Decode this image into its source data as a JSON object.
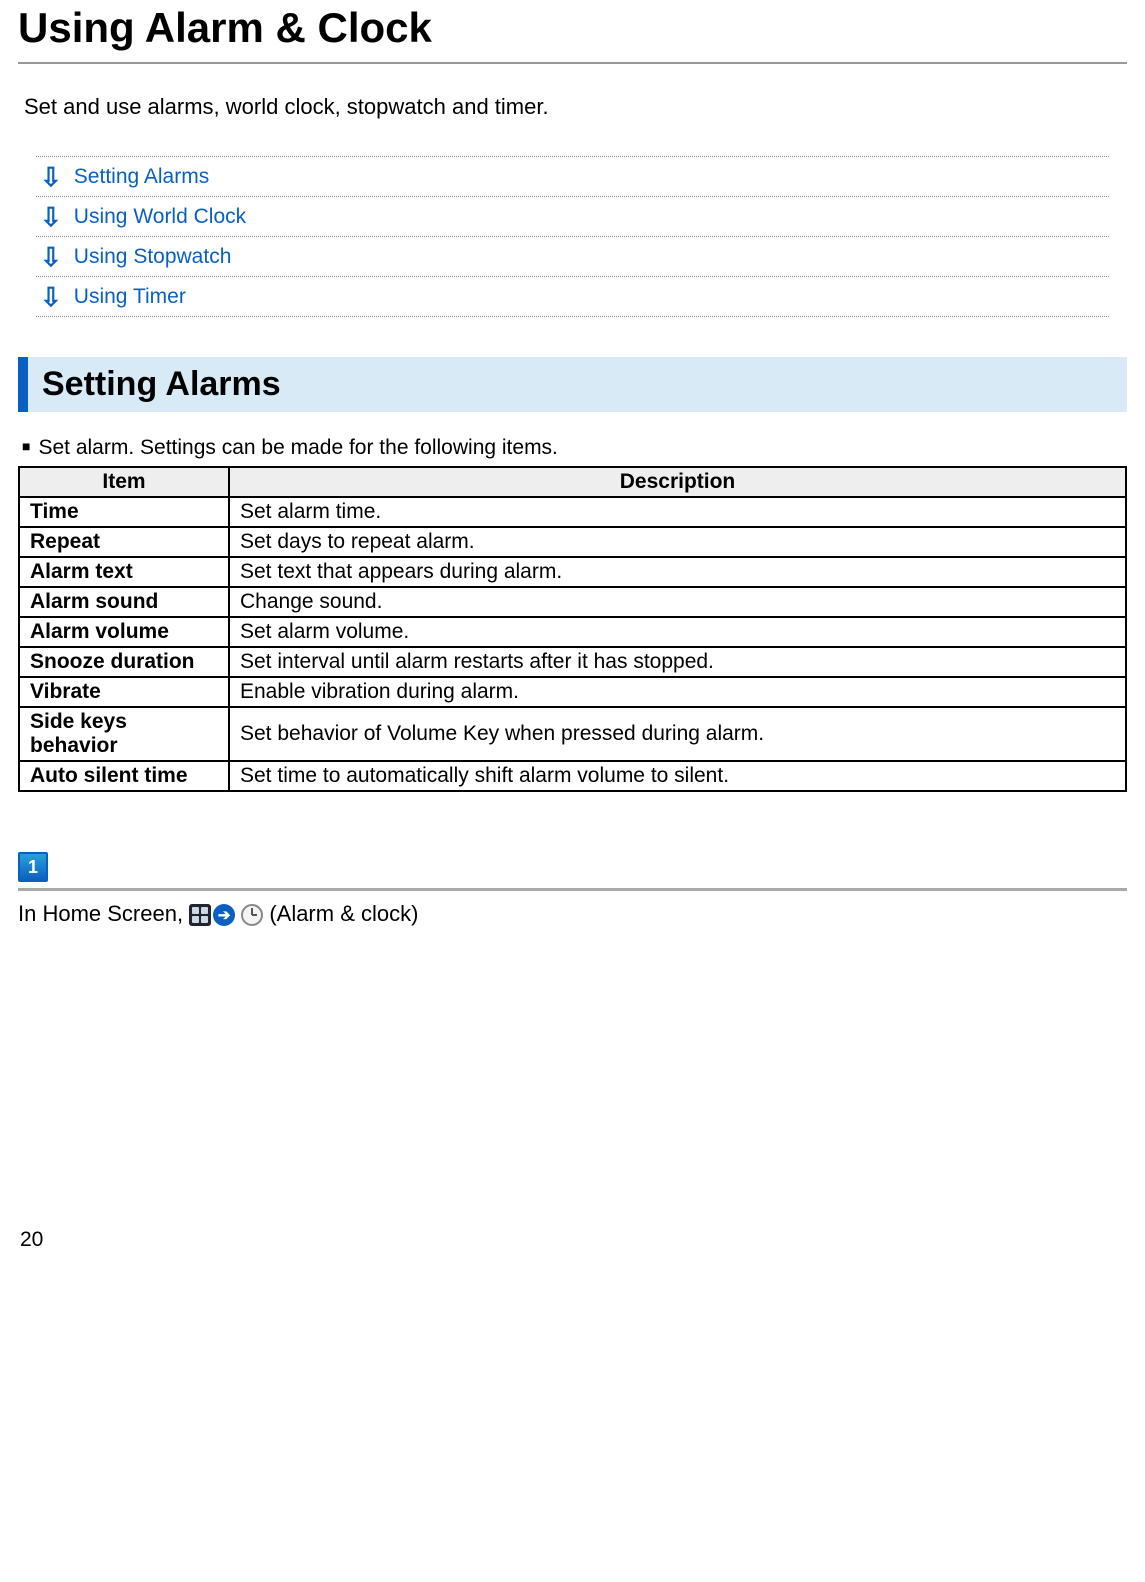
{
  "page": {
    "title": "Using Alarm & Clock",
    "intro": "Set and use alarms, world clock, stopwatch and timer.",
    "number": "20"
  },
  "toc": [
    {
      "label": "Setting Alarms"
    },
    {
      "label": "Using World Clock"
    },
    {
      "label": "Using Stopwatch"
    },
    {
      "label": "Using Timer"
    }
  ],
  "section": {
    "heading": "Setting Alarms",
    "bullet": "Set alarm. Settings can be made for the following items."
  },
  "table": {
    "headers": {
      "item": "Item",
      "description": "Description"
    },
    "rows": [
      {
        "item": "Time",
        "description": "Set alarm time."
      },
      {
        "item": "Repeat",
        "description": "Set days to repeat alarm."
      },
      {
        "item": "Alarm text",
        "description": "Set text that appears during alarm."
      },
      {
        "item": "Alarm sound",
        "description": "Change sound."
      },
      {
        "item": "Alarm volume",
        "description": "Set alarm volume."
      },
      {
        "item": "Snooze duration",
        "description": "Set interval until alarm restarts after it has stopped."
      },
      {
        "item": "Vibrate",
        "description": "Enable vibration during alarm."
      },
      {
        "item": "Side keys behavior",
        "description": "Set behavior of Volume Key when pressed during alarm."
      },
      {
        "item": "Auto silent time",
        "description": "Set time to automatically shift alarm volume to silent."
      }
    ]
  },
  "step": {
    "number": "1",
    "prefix": "In Home Screen, ",
    "suffix": " (Alarm & clock)"
  }
}
